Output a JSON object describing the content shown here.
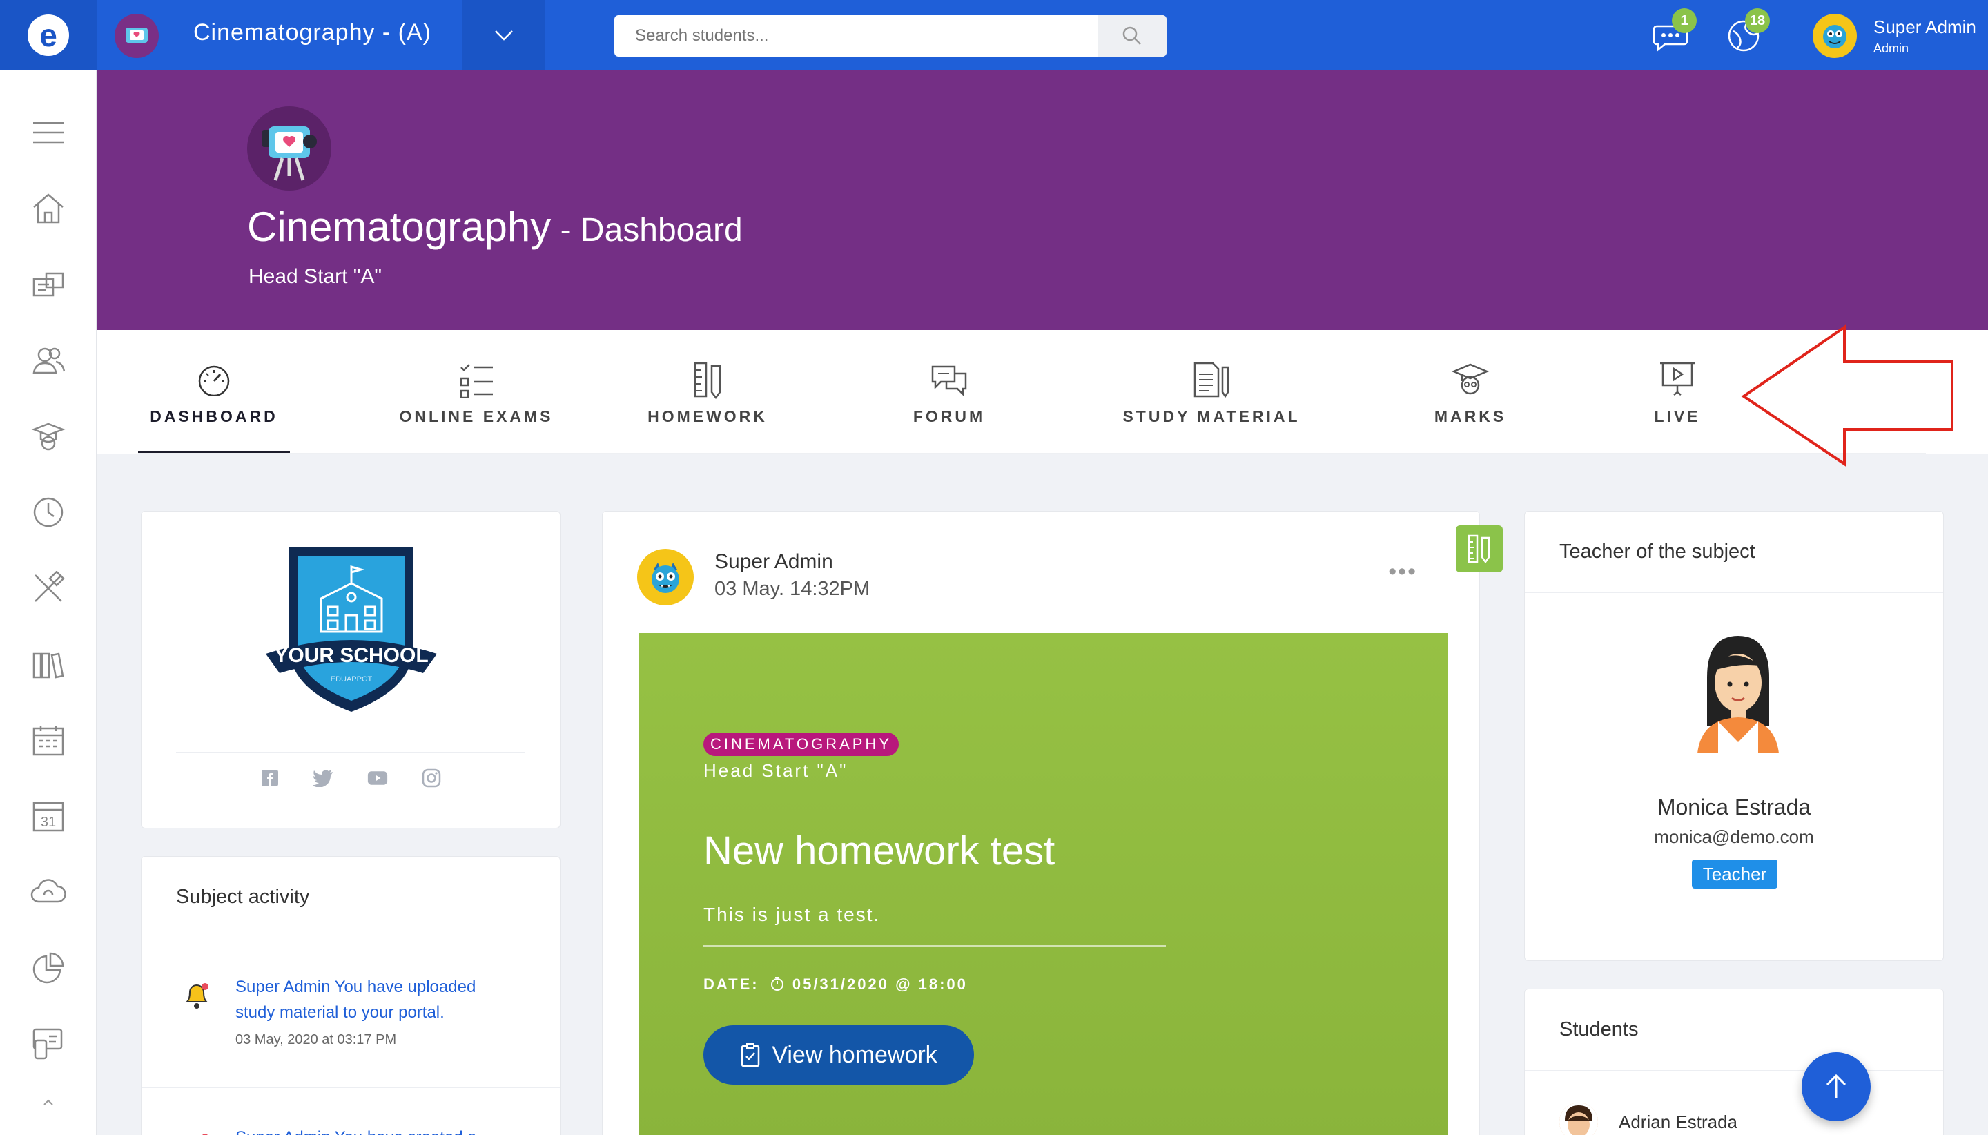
{
  "topbar": {
    "logo_letter": "e",
    "course_title": "Cinematography - (A)",
    "search_placeholder": "Search students...",
    "chat_badge": "1",
    "globe_badge": "18",
    "user_name": "Super Admin",
    "user_role": "Admin"
  },
  "sidebar": {
    "items": [
      "menu",
      "home",
      "mailbox",
      "users",
      "graduation",
      "clock",
      "tools",
      "library",
      "calendar",
      "calendar-31",
      "cloud",
      "chart",
      "chat-phone",
      "more"
    ]
  },
  "hero": {
    "title": "Cinematography",
    "separator": " - ",
    "subtitle_inline": "Dashboard",
    "group": "Head Start \"A\""
  },
  "tabs": [
    {
      "label": "DASHBOARD",
      "icon": "gauge-icon",
      "active": true
    },
    {
      "label": "ONLINE EXAMS",
      "icon": "checklist-icon",
      "active": false
    },
    {
      "label": "HOMEWORK",
      "icon": "ruler-pencil-icon",
      "active": false
    },
    {
      "label": "FORUM",
      "icon": "chat-bubbles-icon",
      "active": false
    },
    {
      "label": "STUDY MATERIAL",
      "icon": "document-pencil-icon",
      "active": false
    },
    {
      "label": "MARKS",
      "icon": "graduation-cap-icon",
      "active": false
    },
    {
      "label": "LIVE",
      "icon": "presentation-play-icon",
      "active": false
    }
  ],
  "school": {
    "badge_line1": "YOUR SCHOOL",
    "badge_line2": "EDUAPPGT"
  },
  "activity": {
    "title": "Subject activity",
    "items": [
      {
        "text": "Super Admin You have uploaded study material to your portal.",
        "line1": "Super Admin You have uploaded",
        "line2": "study material to your portal.",
        "time": "03 May, 2020 at 03:17 PM"
      },
      {
        "line1": "Super Admin You have created a"
      }
    ]
  },
  "post": {
    "author": "Super Admin",
    "date": "03 May. 14:32PM",
    "more": "•••",
    "chip": "CINEMATOGRAPHY",
    "class": "Head Start \"A\"",
    "title": "New homework test",
    "description": "This is just a test.",
    "date_label": "DATE:",
    "due": "05/31/2020 @ 18:00",
    "button": "View homework"
  },
  "teacher": {
    "title": "Teacher of the subject",
    "name": "Monica Estrada",
    "email": "monica@demo.com",
    "badge": "Teacher"
  },
  "students": {
    "title": "Students",
    "first": "Adrian Estrada"
  },
  "colors": {
    "topbar": "#1f5fd8",
    "hero": "#742f85",
    "homework": "#8ab43b",
    "chip": "#b8187c",
    "button": "#1356a8",
    "annotation": "#e0241b"
  }
}
